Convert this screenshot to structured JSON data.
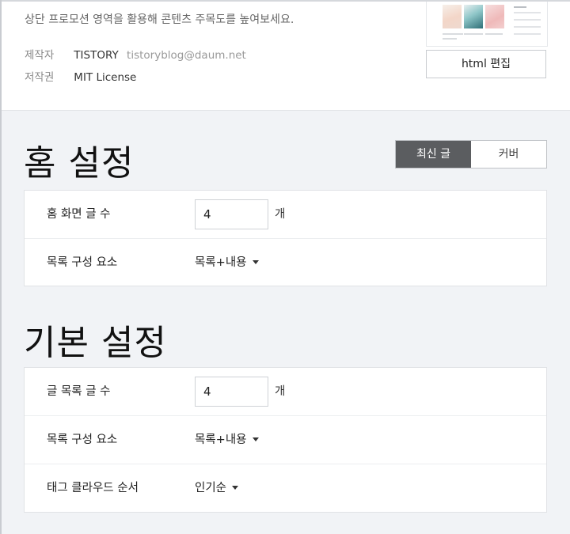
{
  "skin_info": {
    "promo_text": "상단 프로모션 영역을 활용해 콘텐츠 주목도를 높여보세요.",
    "author_label": "제작자",
    "author_name": "TISTORY",
    "author_email": "tistoryblog@daum.net",
    "copyright_label": "저작권",
    "copyright_value": "MIT License",
    "html_edit_label": "html 편집"
  },
  "home_settings": {
    "title": "홈 설정",
    "toggle": {
      "options": [
        "최신 글",
        "커버"
      ],
      "selected": "최신 글"
    },
    "rows": {
      "post_count_label": "홈 화면 글 수",
      "post_count_value": "4",
      "post_count_unit": "개",
      "list_component_label": "목록 구성 요소",
      "list_component_value": "목록+내용"
    }
  },
  "basic_settings": {
    "title": "기본 설정",
    "rows": {
      "post_list_count_label": "글 목록 글 수",
      "post_list_count_value": "4",
      "post_list_count_unit": "개",
      "list_component_label": "목록 구성 요소",
      "list_component_value": "목록+내용",
      "tag_cloud_order_label": "태그 클라우드 순서",
      "tag_cloud_order_value": "인기순"
    }
  },
  "colors": {
    "page_bg": "#f1f3f6",
    "toggle_active_bg": "#5b5d60",
    "panel_bg": "#ffffff"
  }
}
